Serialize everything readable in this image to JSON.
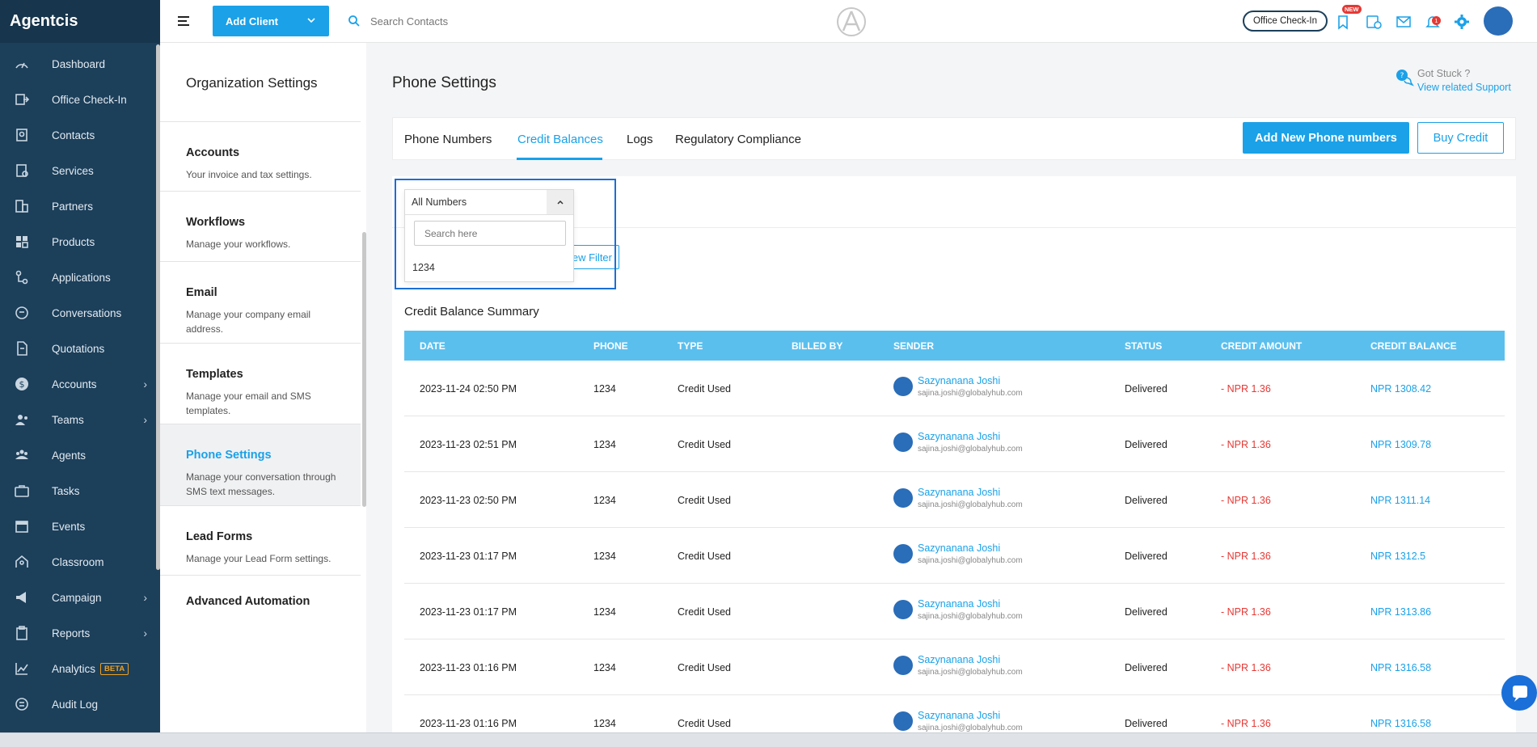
{
  "app": {
    "name": "Agentcis"
  },
  "sidebar": {
    "items": [
      {
        "label": "Dashboard",
        "icon": "gauge-icon",
        "arrow": false
      },
      {
        "label": "Office Check-In",
        "icon": "checkin-icon",
        "arrow": false
      },
      {
        "label": "Contacts",
        "icon": "contacts-icon",
        "arrow": false
      },
      {
        "label": "Services",
        "icon": "services-icon",
        "arrow": false
      },
      {
        "label": "Partners",
        "icon": "building-icon",
        "arrow": false
      },
      {
        "label": "Products",
        "icon": "products-icon",
        "arrow": false
      },
      {
        "label": "Applications",
        "icon": "applications-icon",
        "arrow": false
      },
      {
        "label": "Conversations",
        "icon": "chat-icon",
        "arrow": false
      },
      {
        "label": "Quotations",
        "icon": "document-icon",
        "arrow": false
      },
      {
        "label": "Accounts",
        "icon": "dollar-icon",
        "arrow": true
      },
      {
        "label": "Teams",
        "icon": "team-icon",
        "arrow": true
      },
      {
        "label": "Agents",
        "icon": "agents-icon",
        "arrow": false
      },
      {
        "label": "Tasks",
        "icon": "briefcase-icon",
        "arrow": false
      },
      {
        "label": "Events",
        "icon": "calendar-icon",
        "arrow": false
      },
      {
        "label": "Classroom",
        "icon": "classroom-icon",
        "arrow": false
      },
      {
        "label": "Campaign",
        "icon": "megaphone-icon",
        "arrow": true
      },
      {
        "label": "Reports",
        "icon": "clipboard-icon",
        "arrow": true
      },
      {
        "label": "Analytics",
        "icon": "analytics-icon",
        "arrow": false,
        "badge": "BETA"
      },
      {
        "label": "Audit Log",
        "icon": "audit-icon",
        "arrow": false
      }
    ]
  },
  "header": {
    "add_client_label": "Add Client",
    "search_placeholder": "Search Contacts",
    "office_checkin_label": "Office Check-In",
    "new_badge": "NEW",
    "notification_count": "1"
  },
  "settings_menu": {
    "title": "Organization Settings",
    "items": [
      {
        "title": "Accounts",
        "desc": "Your invoice and tax settings.",
        "active": false
      },
      {
        "title": "Workflows",
        "desc": "Manage your workflows.",
        "active": false
      },
      {
        "title": "Email",
        "desc": "Manage your company email address.",
        "active": false
      },
      {
        "title": "Templates",
        "desc": "Manage your email and SMS templates.",
        "active": false
      },
      {
        "title": "Phone Settings",
        "desc": "Manage your conversation through SMS text messages.",
        "active": true
      },
      {
        "title": "Lead Forms",
        "desc": "Manage your Lead Form settings.",
        "active": false
      },
      {
        "title": "Advanced Automation",
        "desc": "",
        "active": false
      }
    ]
  },
  "main": {
    "title": "Phone Settings",
    "help": {
      "question": "Got Stuck ?",
      "link": "View related Support"
    },
    "tabs": [
      {
        "label": "Phone Numbers",
        "active": false
      },
      {
        "label": "Credit Balances",
        "active": true
      },
      {
        "label": "Logs",
        "active": false
      },
      {
        "label": "Regulatory Compliance",
        "active": false
      }
    ],
    "add_phone_label": "Add New Phone numbers",
    "buy_credit_label": "Buy Credit",
    "filter_label": "ew Filter",
    "dropdown": {
      "selected": "All Numbers",
      "search_placeholder": "Search here",
      "options": [
        "1234"
      ]
    },
    "summary_title": "Credit Balance Summary",
    "table": {
      "columns": [
        "DATE",
        "PHONE",
        "TYPE",
        "BILLED BY",
        "SENDER",
        "STATUS",
        "CREDIT AMOUNT",
        "CREDIT BALANCE"
      ],
      "rows": [
        {
          "date": "2023-11-24 02:50 PM",
          "phone": "1234",
          "type": "Credit Used",
          "billed_by": "",
          "sender_name": "Sazynanana Joshi",
          "sender_email": "sajina.joshi@globalyhub.com",
          "status": "Delivered",
          "amount": "- NPR 1.36",
          "balance": "NPR 1308.42"
        },
        {
          "date": "2023-11-23 02:51 PM",
          "phone": "1234",
          "type": "Credit Used",
          "billed_by": "",
          "sender_name": "Sazynanana Joshi",
          "sender_email": "sajina.joshi@globalyhub.com",
          "status": "Delivered",
          "amount": "- NPR 1.36",
          "balance": "NPR 1309.78"
        },
        {
          "date": "2023-11-23 02:50 PM",
          "phone": "1234",
          "type": "Credit Used",
          "billed_by": "",
          "sender_name": "Sazynanana Joshi",
          "sender_email": "sajina.joshi@globalyhub.com",
          "status": "Delivered",
          "amount": "- NPR 1.36",
          "balance": "NPR 1311.14"
        },
        {
          "date": "2023-11-23 01:17 PM",
          "phone": "1234",
          "type": "Credit Used",
          "billed_by": "",
          "sender_name": "Sazynanana Joshi",
          "sender_email": "sajina.joshi@globalyhub.com",
          "status": "Delivered",
          "amount": "- NPR 1.36",
          "balance": "NPR 1312.5"
        },
        {
          "date": "2023-11-23 01:17 PM",
          "phone": "1234",
          "type": "Credit Used",
          "billed_by": "",
          "sender_name": "Sazynanana Joshi",
          "sender_email": "sajina.joshi@globalyhub.com",
          "status": "Delivered",
          "amount": "- NPR 1.36",
          "balance": "NPR 1313.86"
        },
        {
          "date": "2023-11-23 01:16 PM",
          "phone": "1234",
          "type": "Credit Used",
          "billed_by": "",
          "sender_name": "Sazynanana Joshi",
          "sender_email": "sajina.joshi@globalyhub.com",
          "status": "Delivered",
          "amount": "- NPR 1.36",
          "balance": "NPR 1316.58"
        },
        {
          "date": "2023-11-23 01:16 PM",
          "phone": "1234",
          "type": "Credit Used",
          "billed_by": "",
          "sender_name": "Sazynanana Joshi",
          "sender_email": "sajina.joshi@globalyhub.com",
          "status": "Delivered",
          "amount": "- NPR 1.36",
          "balance": "NPR 1316.58"
        }
      ]
    }
  },
  "colors": {
    "sidebar": "#1c3f5a",
    "accent": "#1aa1e8",
    "negative": "#e53935",
    "table_header": "#5bbfee"
  }
}
